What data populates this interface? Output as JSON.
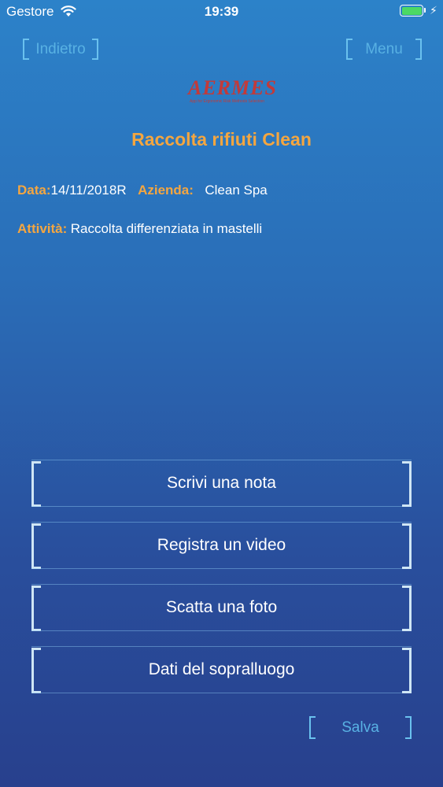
{
  "status_bar": {
    "carrier": "Gestore",
    "time": "19:39",
    "wifi_icon": "wifi-icon",
    "battery_icon": "battery-icon",
    "charging_icon": "charging-bolt-icon"
  },
  "nav": {
    "back_label": "Indietro",
    "menu_label": "Menu"
  },
  "logo": {
    "text": "AERMES",
    "tagline": "App for Ergonomic Risk Methods Selection"
  },
  "page": {
    "title": "Raccolta rifiuti Clean"
  },
  "details": {
    "date_label": "Data:",
    "date_value": "14/11/2018R",
    "company_label": "Azienda:",
    "company_value": "Clean Spa",
    "activity_label": "Attività:",
    "activity_value": "Raccolta differenziata in mastelli"
  },
  "actions": {
    "note": "Scrivi una nota",
    "video": "Registra un video",
    "photo": "Scatta una foto",
    "survey": "Dati del sopralluogo"
  },
  "save_label": "Salva",
  "colors": {
    "accent": "#f4a640",
    "nav_blue": "#58b1e3",
    "bg_top": "#2c82c9",
    "bg_bottom": "#28408d"
  }
}
